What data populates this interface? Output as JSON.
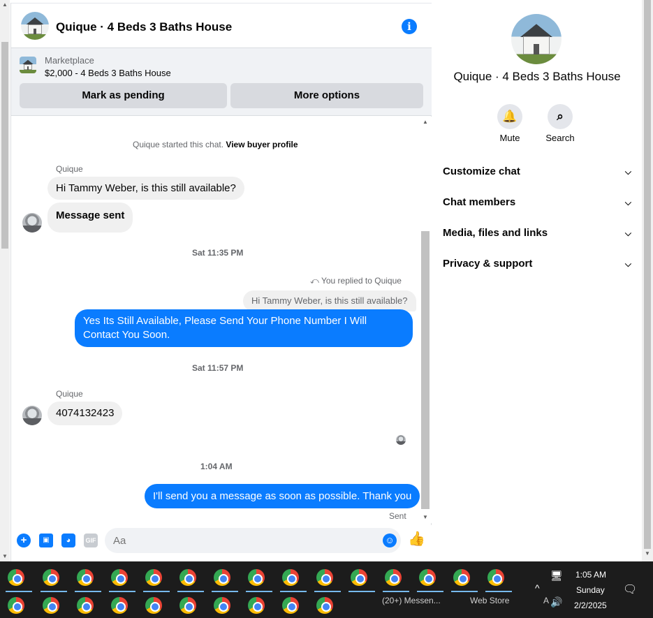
{
  "chat": {
    "title": "Quique · 4 Beds 3 Baths House",
    "info_icon": "info-icon"
  },
  "marketplace": {
    "label": "Marketplace",
    "item": "$2,000 - 4 Beds 3 Baths House",
    "pending_button": "Mark as pending",
    "more_button": "More options"
  },
  "messages": {
    "started_text": "Quique started this chat.",
    "buyer_profile_link": "View buyer profile",
    "sender_1": "Quique",
    "msg_1": "Hi Tammy Weber, is this still available?",
    "msg_2": "Message sent",
    "ts_1": "Sat 11:35 PM",
    "replied_label": "You replied to Quique",
    "reply_quote": "Hi Tammy Weber, is this still available?",
    "msg_3": "Yes Its Still Available, Please Send Your Phone Number I Will Contact You Soon.",
    "ts_2": "Sat 11:57 PM",
    "sender_2": "Quique",
    "msg_4": "4074132423",
    "ts_3": "1:04 AM",
    "msg_5": "I'll send you a message as soon as possible. Thank you",
    "status": "Sent"
  },
  "composer": {
    "placeholder": "Aa",
    "icons": [
      "plus-icon",
      "image-icon",
      "sticker-icon",
      "gif-icon",
      "emoji-icon",
      "thumbs-up-icon"
    ],
    "gif_label": "GIF"
  },
  "info_panel": {
    "title": "Quique · 4 Beds 3 Baths House",
    "mute_label": "Mute",
    "search_label": "Search",
    "rows": [
      "Customize chat",
      "Chat members",
      "Media, files and links",
      "Privacy & support"
    ]
  },
  "taskbar": {
    "label_messenger": "(20+) Messen...",
    "label_webstore": "Web Store",
    "label_partial": "A",
    "time": "1:05 AM",
    "day": "Sunday",
    "date": "2/2/2025"
  },
  "colors": {
    "accent": "#0a7cff",
    "bubble_in": "#f0f0f0",
    "taskbar": "#1c1c1c"
  }
}
